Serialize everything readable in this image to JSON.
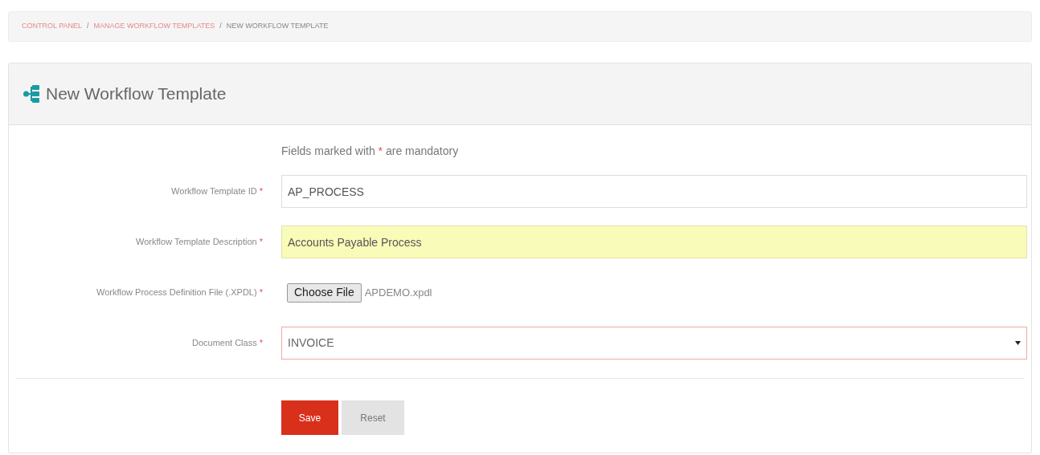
{
  "breadcrumb": [
    {
      "label": "CONTROL PANEL",
      "current": false
    },
    {
      "label": "MANAGE WORKFLOW TEMPLATES",
      "current": false
    },
    {
      "label": "NEW WORKFLOW TEMPLATE",
      "current": true
    }
  ],
  "breadcrumb_separator": "/",
  "panel": {
    "title": "New Workflow Template"
  },
  "note": {
    "before": "Fields marked with",
    "asterisk": "*",
    "after": "are mandatory"
  },
  "fields": [
    {
      "kind": "text",
      "label": "Workflow Template ID",
      "required": true,
      "value": "AP_PROCESS",
      "highlighted": false,
      "error": false
    },
    {
      "kind": "text",
      "label": "Workflow Template Description",
      "required": true,
      "value": "Accounts Payable Process",
      "highlighted": true,
      "error": false
    },
    {
      "kind": "file",
      "label": "Workflow Process Definition File (.XPDL)",
      "required": true,
      "button": "Choose File",
      "value": "APDEMO.xpdl"
    },
    {
      "kind": "select",
      "label": "Document Class",
      "required": true,
      "value": "INVOICE",
      "highlighted": false,
      "error": true
    }
  ],
  "buttons": [
    {
      "kind": "primary",
      "label": "Save"
    },
    {
      "kind": "secondary",
      "label": "Reset"
    }
  ]
}
